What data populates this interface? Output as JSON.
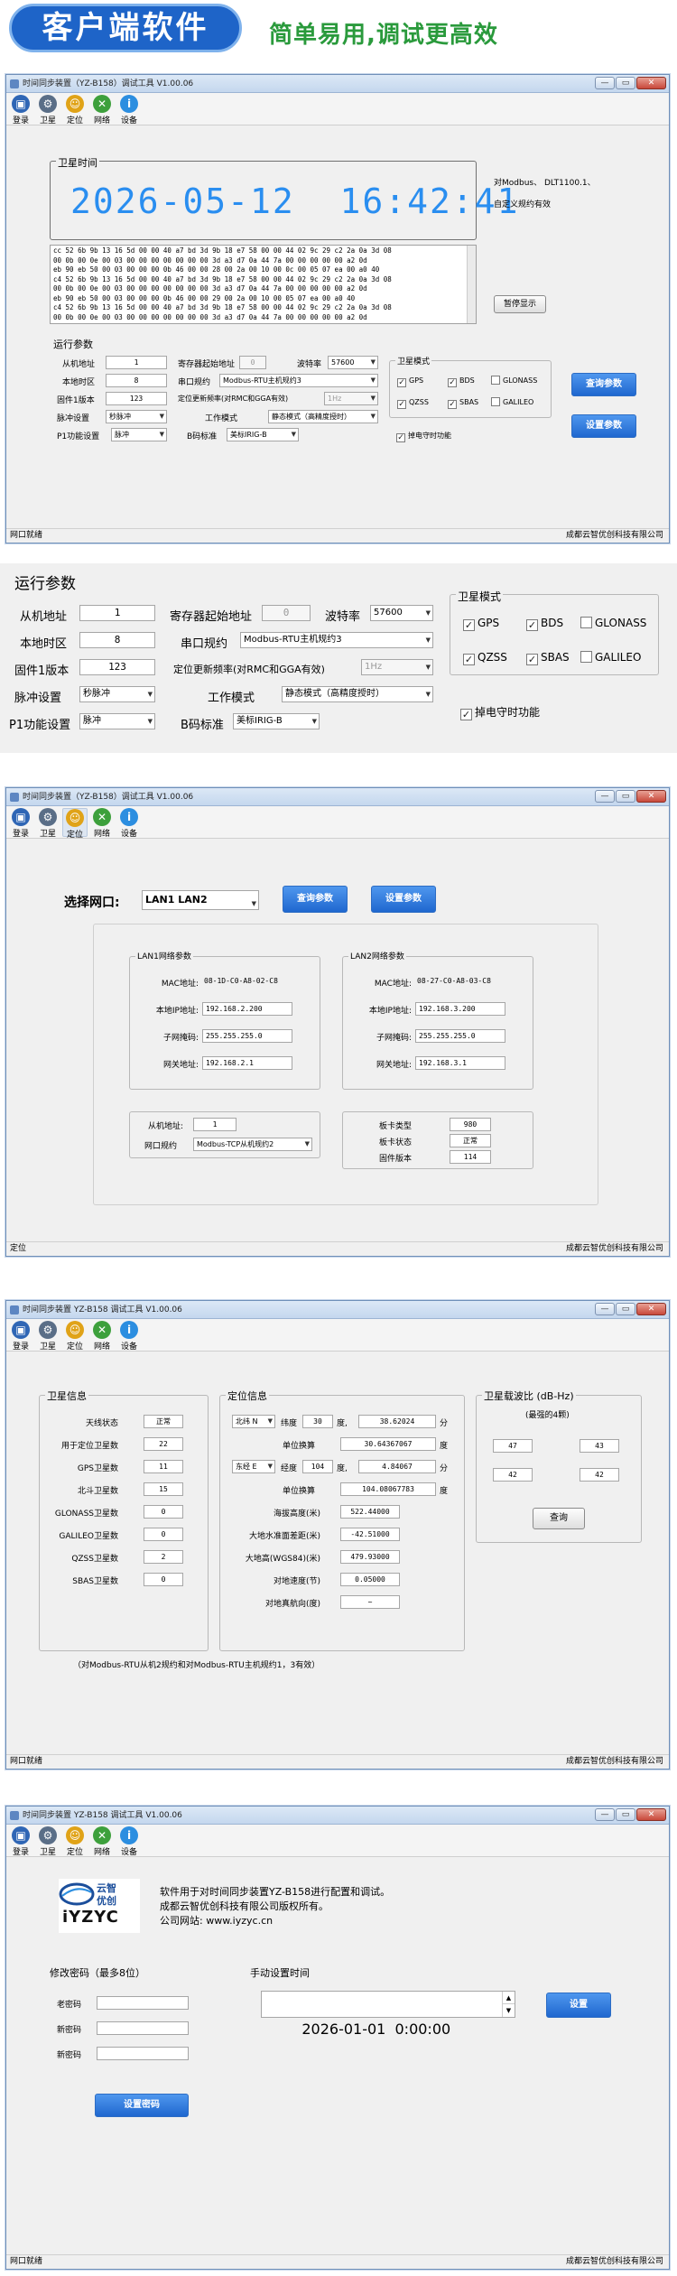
{
  "hero": {
    "badge": "客户端软件",
    "subtitle": "简单易用,调试更高效"
  },
  "app": {
    "title": "时间同步装置（YZ-B158）调试工具 V1.00.06",
    "title_short": "时间同步装置 YZ-B158 调试工具 V1.00.06",
    "toolbar": [
      {
        "label": "登录",
        "icon": "monitor-icon",
        "color": "#2f66b5"
      },
      {
        "label": "卫星",
        "icon": "gear-icon",
        "color": "#5a6e87"
      },
      {
        "label": "定位",
        "icon": "person-icon",
        "color": "#e0a318"
      },
      {
        "label": "网络",
        "icon": "tools-icon",
        "color": "#3da03c"
      },
      {
        "label": "设备",
        "icon": "info-icon",
        "color": "#2c8ee0"
      }
    ],
    "window_buttons": {
      "min": "—",
      "max": "▭",
      "close": "✕"
    },
    "company": "成都云智优创科技有限公司",
    "status_port_ready": "网口就绪",
    "status_locate": "定位",
    "status_ready_short": "网口就绪"
  },
  "win1": {
    "sat_time_title": "卫星时间",
    "sat_time_value": "2026-05-12  16:42:41",
    "note_line1": "对Modbus、 DLT1100.1、",
    "note_line2": "自定义规约有效",
    "hex_lines": [
      "cc 52 6b 9b 13 16 5d 00 00 40 a7 bd 3d 9b 18 e7 58 00 00 44 02 9c 29 c2 2a 0a 3d 08",
      "00 0b 00 0e 00 03 00 00 00 00 00 00 00 3d a3 d7 0a 44 7a 00 00 00 00 00 a2 0d",
      "eb 90 eb 50 00 03 00 00 00 0b 46 00 00 28 00 2a 00 10 00 0c 00 05 07 ea 00 a0 40",
      "c4 52 6b 9b 13 16 5d 00 00 40 a7 bd 3d 9b 18 e7 58 00 00 44 02 9c 29 c2 2a 0a 3d 08",
      "00 0b 00 0e 00 03 00 00 00 00 00 00 00 3d a3 d7 0a 44 7a 00 00 00 00 00 a2 0d",
      "eb 90 eb 50 00 03 00 00 00 0b 46 00 00 29 00 2a 00 10 00 05 07 ea 00 a0 40",
      "c4 52 6b 9b 13 16 5d 00 00 40 a7 bd 3d 9b 18 e7 58 00 00 44 02 9c 29 c2 2a 0a 3d 08",
      "00 0b 00 0e 00 03 00 00 00 00 00 00 00 3d a3 d7 0a 44 7a 00 00 00 00 00 a2 0d"
    ],
    "pause_btn": "暂停显示",
    "run_params_title": "运行参数",
    "query_btn": "查询参数",
    "set_btn": "设置参数"
  },
  "run_params": {
    "slave_addr_label": "从机地址",
    "slave_addr": "1",
    "reg_start_label": "寄存器起始地址",
    "reg_start": "0",
    "baud_label": "波特率",
    "baud": "57600",
    "timezone_label": "本地时区",
    "timezone": "8",
    "protocol_label": "串口规约",
    "protocol": "Modbus-RTU主机规约3",
    "firmware_label": "固件1版本",
    "firmware": "123",
    "freq_label": "定位更新频率(对RMC和GGA有效)",
    "freq": "1Hz",
    "pulse_label": "脉冲设置",
    "pulse": "秒脉冲",
    "mode_label": "工作模式",
    "mode": "静态模式（高精度授时）",
    "p1_label": "P1功能设置",
    "p1": "脉冲",
    "bcode_label": "B码标准",
    "bcode": "美标IRIG-B",
    "sat_mode_title": "卫星模式",
    "sat_modes": [
      {
        "name": "GPS",
        "checked": true
      },
      {
        "name": "BDS",
        "checked": true
      },
      {
        "name": "GLONASS",
        "checked": false
      },
      {
        "name": "QZSS",
        "checked": true
      },
      {
        "name": "SBAS",
        "checked": true
      },
      {
        "name": "GALILEO",
        "checked": false
      }
    ],
    "power_keep_label": "掉电守时功能",
    "power_keep": true
  },
  "win2": {
    "select_port_label": "选择网口:",
    "port_value": "LAN1  LAN2",
    "query_btn": "查询参数",
    "set_btn": "设置参数",
    "lan1": {
      "title": "LAN1网络参数",
      "mac_label": "MAC地址:",
      "mac": "08-1D-C0-A8-02-C8",
      "ip_label": "本地IP地址:",
      "ip": "192.168.2.200",
      "mask_label": "子网掩码:",
      "mask": "255.255.255.0",
      "gw_label": "网关地址:",
      "gw": "192.168.2.1"
    },
    "lan2": {
      "title": "LAN2网络参数",
      "mac_label": "MAC地址:",
      "mac": "08-27-C0-A8-03-C8",
      "ip_label": "本地IP地址:",
      "ip": "192.168.3.200",
      "mask_label": "子网掩码:",
      "mask": "255.255.255.0",
      "gw_label": "网关地址:",
      "gw": "192.168.3.1"
    },
    "slave_label": "从机地址:",
    "slave": "1",
    "net_protocol_label": "网口规约",
    "net_protocol": "Modbus-TCP从机规约2",
    "card_type_label": "板卡类型",
    "card_type": "980",
    "card_status_label": "板卡状态",
    "card_status": "正常",
    "fw_label": "固件版本",
    "fw": "114"
  },
  "win3": {
    "sat_info_title": "卫星信息",
    "sat_rows": [
      {
        "label": "天线状态",
        "value": "正常"
      },
      {
        "label": "用于定位卫星数",
        "value": "22"
      },
      {
        "label": "GPS卫星数",
        "value": "11"
      },
      {
        "label": "北斗卫星数",
        "value": "15"
      },
      {
        "label": "GLONASS卫星数",
        "value": "0"
      },
      {
        "label": "GALILEO卫星数",
        "value": "0"
      },
      {
        "label": "QZSS卫星数",
        "value": "2"
      },
      {
        "label": "SBAS卫星数",
        "value": "0"
      }
    ],
    "pos_title": "定位信息",
    "lat_dir": "北纬 N",
    "lat_label": "纬度",
    "lat_deg": "30",
    "deg_unit": "度,",
    "lat_min": "38.62024",
    "min_unit": "分",
    "lat_conv_label": "单位换算",
    "lat_conv": "30.64367067",
    "lat_conv_unit": "度",
    "lon_dir": "东经 E",
    "lon_label": "经度",
    "lon_deg": "104",
    "lon_min": "4.84067",
    "lon_conv_label": "单位换算",
    "lon_conv": "104.08067783",
    "lon_conv_unit": "度",
    "alt_label": "海拔高度(米)",
    "alt": "522.44000",
    "geoid_label": "大地水准面差距(米)",
    "geoid": "-42.51000",
    "ellh_label": "大地高(WGS84)(米)",
    "ellh": "479.93000",
    "speed_label": "对地速度(节)",
    "speed": "0.05000",
    "course_label": "对地真航向(度)",
    "course": "~",
    "cn_title": "卫星载波比 (dB-Hz)",
    "cn_sub": "(最强的4颗)",
    "cn_values": [
      "47",
      "43",
      "42",
      "42"
    ],
    "query_btn": "查询",
    "footnote": "（对Modbus-RTU从机2规约和对Modbus-RTU主机规约1，3有效）"
  },
  "win4": {
    "logo_cn1": "云智",
    "logo_cn2": "优创",
    "logo_en": "iYZYC",
    "about1": "软件用于对时间同步装置YZ-B158进行配置和调试。",
    "about2": "成都云智优创科技有限公司版权所有。",
    "about3": "公司网站: www.iyzyc.cn",
    "pwd_title": "修改密码（最多8位）",
    "old_pwd": "老密码",
    "new_pwd": "新密码",
    "new_pwd2": "新密码",
    "set_pwd_btn": "设置密码",
    "manual_title": "手动设置时间",
    "datetime": "2026-01-01  0:00:00",
    "set_btn": "设置"
  }
}
